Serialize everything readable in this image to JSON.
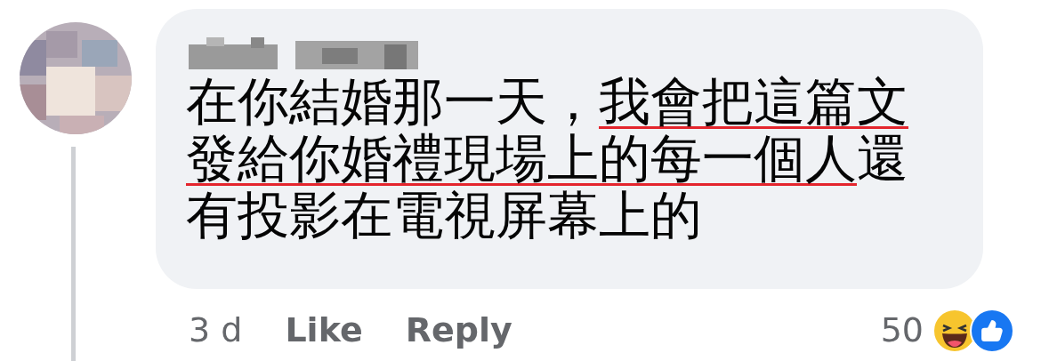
{
  "comment": {
    "lines": [
      [
        {
          "text": "在你結婚那一天，",
          "underlined": false
        },
        {
          "text": "我會把這篇文",
          "underlined": true
        }
      ],
      [
        {
          "text": "發給你婚禮現場上的每一個人",
          "underlined": true
        },
        {
          "text": "還",
          "underlined": false
        }
      ],
      [
        {
          "text": "有投影在電視屏幕上的",
          "underlined": false
        }
      ]
    ]
  },
  "footer": {
    "time": "3 d",
    "actions": [
      "Like",
      "Reply"
    ],
    "reaction_count": "50",
    "reactions": [
      {
        "kind": "haha"
      },
      {
        "kind": "like"
      }
    ]
  }
}
